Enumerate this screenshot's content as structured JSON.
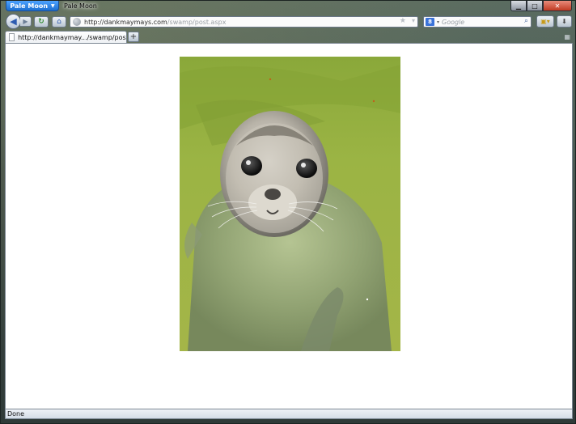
{
  "app": {
    "menu_button_label": "Pale Moon",
    "window_title": "Pale Moon"
  },
  "window_controls": {
    "minimize": "▁",
    "maximize": "□",
    "close": "✕"
  },
  "nav": {
    "back_icon": "arrow-left-icon",
    "forward_icon": "arrow-right-icon",
    "reload_icon": "reload-icon",
    "home_icon": "home-icon",
    "back_glyph": "◀",
    "forward_glyph": "▶",
    "reload_glyph": "↻",
    "home_glyph": "⌂"
  },
  "urlbar": {
    "url_domain": "http://dankmaymays.com",
    "url_path": "/swamp/post.aspx",
    "star_glyph": "★",
    "dropdown_glyph": "▾"
  },
  "searchbar": {
    "engine_letter": "8",
    "placeholder": "Google",
    "go_glyph": "⌕"
  },
  "tabs": [
    {
      "label": "http://dankmaymay.../swamp/post.aspx"
    }
  ],
  "new_tab_glyph": "+",
  "content": {
    "image_description_icon": "seal-photo"
  },
  "status": {
    "text": "Done"
  },
  "colors": {
    "app_button": "#1d6fd1",
    "close_button": "#c03a22",
    "water": "#9bb444"
  }
}
